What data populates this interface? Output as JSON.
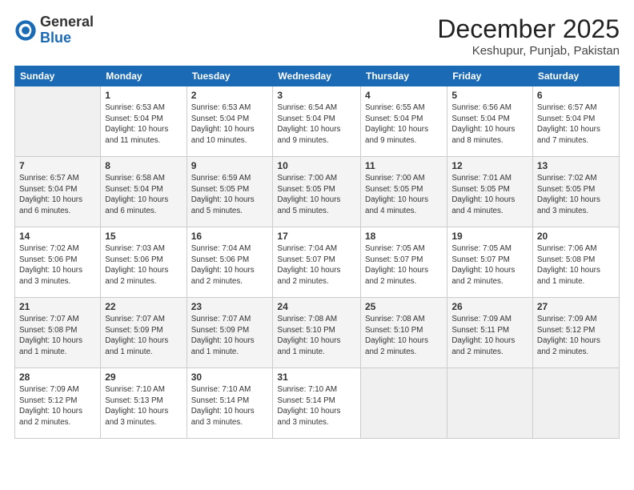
{
  "header": {
    "logo_general": "General",
    "logo_blue": "Blue",
    "month_title": "December 2025",
    "location": "Keshupur, Punjab, Pakistan"
  },
  "days_of_week": [
    "Sunday",
    "Monday",
    "Tuesday",
    "Wednesday",
    "Thursday",
    "Friday",
    "Saturday"
  ],
  "weeks": [
    [
      {
        "num": "",
        "info": ""
      },
      {
        "num": "1",
        "info": "Sunrise: 6:53 AM\nSunset: 5:04 PM\nDaylight: 10 hours\nand 11 minutes."
      },
      {
        "num": "2",
        "info": "Sunrise: 6:53 AM\nSunset: 5:04 PM\nDaylight: 10 hours\nand 10 minutes."
      },
      {
        "num": "3",
        "info": "Sunrise: 6:54 AM\nSunset: 5:04 PM\nDaylight: 10 hours\nand 9 minutes."
      },
      {
        "num": "4",
        "info": "Sunrise: 6:55 AM\nSunset: 5:04 PM\nDaylight: 10 hours\nand 9 minutes."
      },
      {
        "num": "5",
        "info": "Sunrise: 6:56 AM\nSunset: 5:04 PM\nDaylight: 10 hours\nand 8 minutes."
      },
      {
        "num": "6",
        "info": "Sunrise: 6:57 AM\nSunset: 5:04 PM\nDaylight: 10 hours\nand 7 minutes."
      }
    ],
    [
      {
        "num": "7",
        "info": "Sunrise: 6:57 AM\nSunset: 5:04 PM\nDaylight: 10 hours\nand 6 minutes."
      },
      {
        "num": "8",
        "info": "Sunrise: 6:58 AM\nSunset: 5:04 PM\nDaylight: 10 hours\nand 6 minutes."
      },
      {
        "num": "9",
        "info": "Sunrise: 6:59 AM\nSunset: 5:05 PM\nDaylight: 10 hours\nand 5 minutes."
      },
      {
        "num": "10",
        "info": "Sunrise: 7:00 AM\nSunset: 5:05 PM\nDaylight: 10 hours\nand 5 minutes."
      },
      {
        "num": "11",
        "info": "Sunrise: 7:00 AM\nSunset: 5:05 PM\nDaylight: 10 hours\nand 4 minutes."
      },
      {
        "num": "12",
        "info": "Sunrise: 7:01 AM\nSunset: 5:05 PM\nDaylight: 10 hours\nand 4 minutes."
      },
      {
        "num": "13",
        "info": "Sunrise: 7:02 AM\nSunset: 5:05 PM\nDaylight: 10 hours\nand 3 minutes."
      }
    ],
    [
      {
        "num": "14",
        "info": "Sunrise: 7:02 AM\nSunset: 5:06 PM\nDaylight: 10 hours\nand 3 minutes."
      },
      {
        "num": "15",
        "info": "Sunrise: 7:03 AM\nSunset: 5:06 PM\nDaylight: 10 hours\nand 2 minutes."
      },
      {
        "num": "16",
        "info": "Sunrise: 7:04 AM\nSunset: 5:06 PM\nDaylight: 10 hours\nand 2 minutes."
      },
      {
        "num": "17",
        "info": "Sunrise: 7:04 AM\nSunset: 5:07 PM\nDaylight: 10 hours\nand 2 minutes."
      },
      {
        "num": "18",
        "info": "Sunrise: 7:05 AM\nSunset: 5:07 PM\nDaylight: 10 hours\nand 2 minutes."
      },
      {
        "num": "19",
        "info": "Sunrise: 7:05 AM\nSunset: 5:07 PM\nDaylight: 10 hours\nand 2 minutes."
      },
      {
        "num": "20",
        "info": "Sunrise: 7:06 AM\nSunset: 5:08 PM\nDaylight: 10 hours\nand 1 minute."
      }
    ],
    [
      {
        "num": "21",
        "info": "Sunrise: 7:07 AM\nSunset: 5:08 PM\nDaylight: 10 hours\nand 1 minute."
      },
      {
        "num": "22",
        "info": "Sunrise: 7:07 AM\nSunset: 5:09 PM\nDaylight: 10 hours\nand 1 minute."
      },
      {
        "num": "23",
        "info": "Sunrise: 7:07 AM\nSunset: 5:09 PM\nDaylight: 10 hours\nand 1 minute."
      },
      {
        "num": "24",
        "info": "Sunrise: 7:08 AM\nSunset: 5:10 PM\nDaylight: 10 hours\nand 1 minute."
      },
      {
        "num": "25",
        "info": "Sunrise: 7:08 AM\nSunset: 5:10 PM\nDaylight: 10 hours\nand 2 minutes."
      },
      {
        "num": "26",
        "info": "Sunrise: 7:09 AM\nSunset: 5:11 PM\nDaylight: 10 hours\nand 2 minutes."
      },
      {
        "num": "27",
        "info": "Sunrise: 7:09 AM\nSunset: 5:12 PM\nDaylight: 10 hours\nand 2 minutes."
      }
    ],
    [
      {
        "num": "28",
        "info": "Sunrise: 7:09 AM\nSunset: 5:12 PM\nDaylight: 10 hours\nand 2 minutes."
      },
      {
        "num": "29",
        "info": "Sunrise: 7:10 AM\nSunset: 5:13 PM\nDaylight: 10 hours\nand 3 minutes."
      },
      {
        "num": "30",
        "info": "Sunrise: 7:10 AM\nSunset: 5:14 PM\nDaylight: 10 hours\nand 3 minutes."
      },
      {
        "num": "31",
        "info": "Sunrise: 7:10 AM\nSunset: 5:14 PM\nDaylight: 10 hours\nand 3 minutes."
      },
      {
        "num": "",
        "info": ""
      },
      {
        "num": "",
        "info": ""
      },
      {
        "num": "",
        "info": ""
      }
    ]
  ]
}
